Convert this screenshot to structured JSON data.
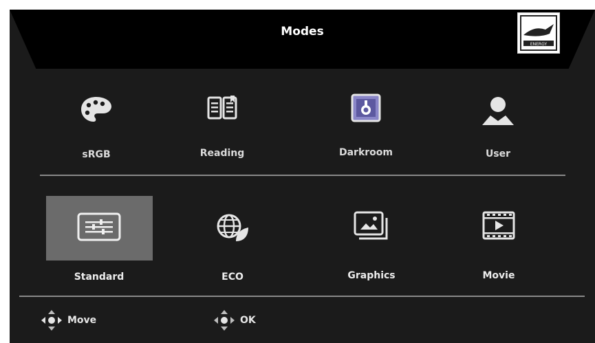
{
  "header": {
    "title": "Modes",
    "logo_icon": "energy-star-icon"
  },
  "modes_row1": [
    {
      "label": "sRGB",
      "icon": "palette-icon"
    },
    {
      "label": "Reading",
      "icon": "book-icon"
    },
    {
      "label": "Darkroom",
      "icon": "darkroom-icon"
    },
    {
      "label": "User",
      "icon": "user-icon"
    }
  ],
  "modes_row2": [
    {
      "label": "Standard",
      "icon": "sliders-icon",
      "selected": true
    },
    {
      "label": "ECO",
      "icon": "eco-globe-icon"
    },
    {
      "label": "Graphics",
      "icon": "picture-icon"
    },
    {
      "label": "Movie",
      "icon": "film-icon"
    }
  ],
  "footer": {
    "move_label": "Move",
    "ok_label": "OK"
  },
  "colors": {
    "background": "#1b1b1b",
    "header": "#000000",
    "selected": "#6b6b6b",
    "darkroom_accent": "#8a86c8"
  }
}
